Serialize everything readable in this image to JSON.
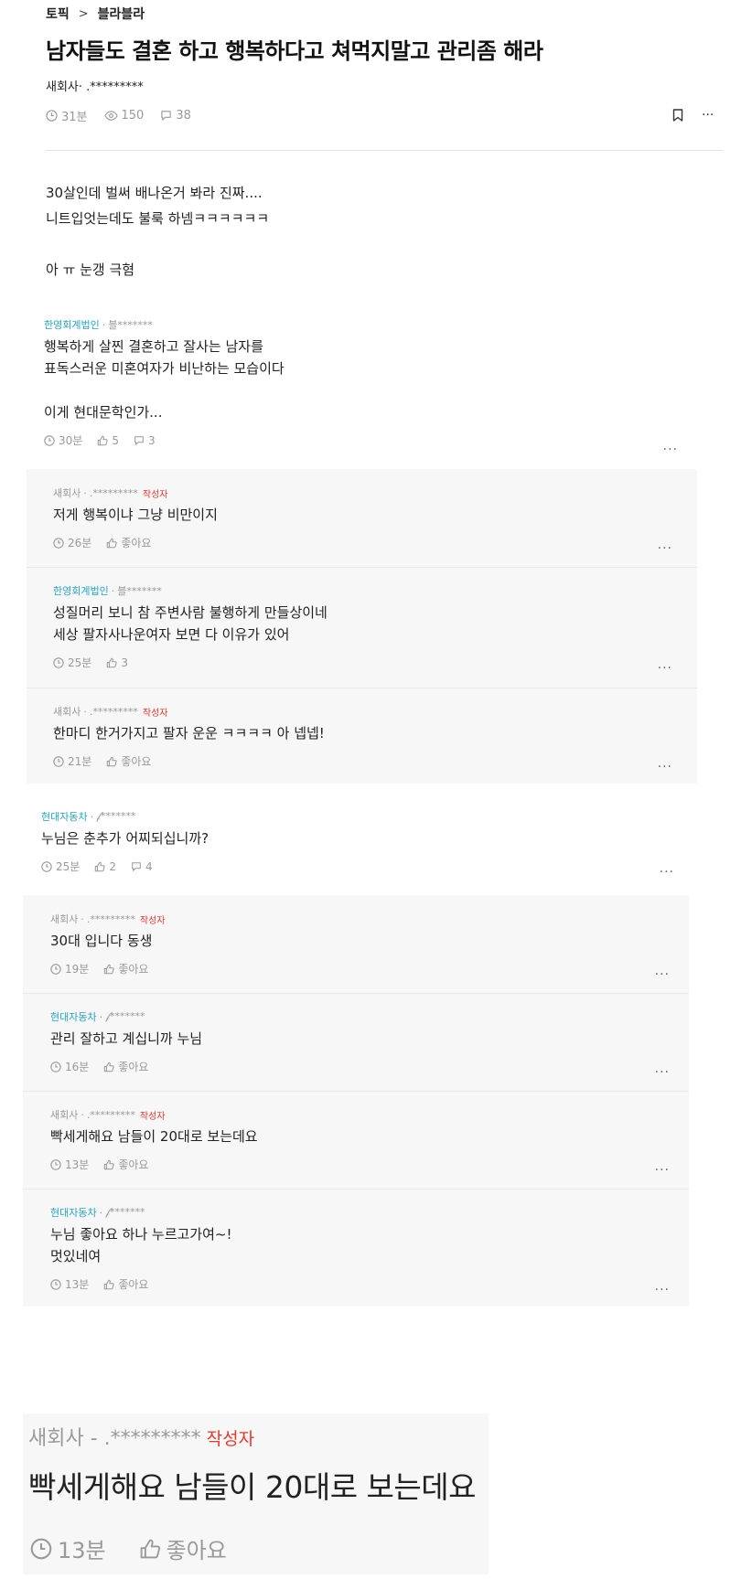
{
  "breadcrumb": {
    "topic": "토픽",
    "separator": ">",
    "board": "블라블라"
  },
  "post": {
    "title": "남자들도 결혼 하고 행복하다고 쳐먹지말고 관리좀 해라",
    "author": "새회사· .*********",
    "time": "31분",
    "views": "150",
    "comments": "38",
    "body": "30살인데 벌써 배나온거 봐라 진짜....\n니트입엇는데도 불룩 하넴ㅋㅋㅋㅋㅋㅋ\n\n아 ㅠ 눈갱 극혐"
  },
  "comments": [
    {
      "company": "한영회계법인",
      "nick": "블*******",
      "writer": "",
      "text": "행복하게 살찐 결혼하고 잘사는 남자를\n표독스러운 미혼여자가 비난하는 모습이다\n\n이게 현대문학인가...",
      "time": "30분",
      "likes": "5",
      "replies": "3"
    },
    {
      "company": "새회사",
      "nick": ".*********",
      "writer": "작성자",
      "text": "저게 행복이냐 그냥 비만이지",
      "time": "26분",
      "likes": "좋아요"
    },
    {
      "company": "한영회계법인",
      "nick": "블*******",
      "writer": "",
      "text": "성질머리 보니 참 주변사람 불행하게 만들상이네\n세상 팔자사나운여자 보면 다 이유가 있어",
      "time": "25분",
      "likes": "3"
    },
    {
      "company": "새회사",
      "nick": ".*********",
      "writer": "작성자",
      "text": "한마디 한거가지고 팔자 운운 ㅋㅋㅋㅋ 아 넵넵!",
      "time": "21분",
      "likes": "좋아요"
    },
    {
      "company": "현대자동차",
      "nick": "𝒻*******",
      "writer": "",
      "text": "누님은 춘추가 어찌되십니까?",
      "time": "25분",
      "likes": "2",
      "replies": "4"
    },
    {
      "company": "새회사",
      "nick": ".*********",
      "writer": "작성자",
      "text": "30대 입니다 동생",
      "time": "19분",
      "likes": "좋아요"
    },
    {
      "company": "현대자동차",
      "nick": "𝒻*******",
      "writer": "",
      "text": "관리 잘하고 계십니까 누님",
      "time": "16분",
      "likes": "좋아요"
    },
    {
      "company": "새회사",
      "nick": ".*********",
      "writer": "작성자",
      "text": "빡세게해요 남들이 20대로 보는데요",
      "time": "13분",
      "likes": "좋아요"
    },
    {
      "company": "현대자동차",
      "nick": "𝒻*******",
      "writer": "",
      "text": "누님 좋아요 하나 누르고가여~!\n멋있네여",
      "time": "13분",
      "likes": "좋아요"
    }
  ],
  "zoom": {
    "meta": "새회사 - .*********",
    "writer": "작성자",
    "text": "빡세게해요 남들이 20대로 보는데요",
    "time": "13분",
    "likes": "좋아요"
  },
  "more_label": "···",
  "colors": {
    "company": "#27a5c4",
    "writer_badge": "#e2382d",
    "reply_bg": "#f7f7f7"
  }
}
